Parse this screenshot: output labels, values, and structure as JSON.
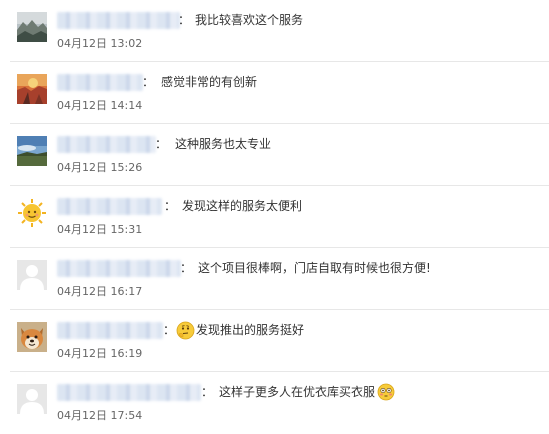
{
  "comments": [
    {
      "avatar_icon": "mountain-landscape-avatar",
      "text": "我比较喜欢这个服务",
      "time": "04月12日 13:02"
    },
    {
      "avatar_icon": "sunset-field-avatar",
      "text": "感觉非常的有创新",
      "time": "04月12日 14:14"
    },
    {
      "avatar_icon": "sky-horizon-avatar",
      "text": "这种服务也太专业",
      "time": "04月12日 15:26"
    },
    {
      "avatar_icon": "sun-face-avatar",
      "text": "发现这样的服务太便利",
      "time": "04月12日 15:31"
    },
    {
      "avatar_icon": "default-user-avatar",
      "text": "这个项目很棒啊，门店自取有时候也很方便!",
      "time": "04月12日 16:17"
    },
    {
      "avatar_icon": "shiba-dog-avatar",
      "emoji_before": "thinking-face-emoji",
      "text": "发现推出的服务挺好",
      "time": "04月12日 16:19"
    },
    {
      "avatar_icon": "default-user-avatar",
      "text": "这样子更多人在优衣库买衣服",
      "emoji_after": "flushed-face-emoji",
      "time": "04月12日 17:54"
    }
  ],
  "colon": "："
}
